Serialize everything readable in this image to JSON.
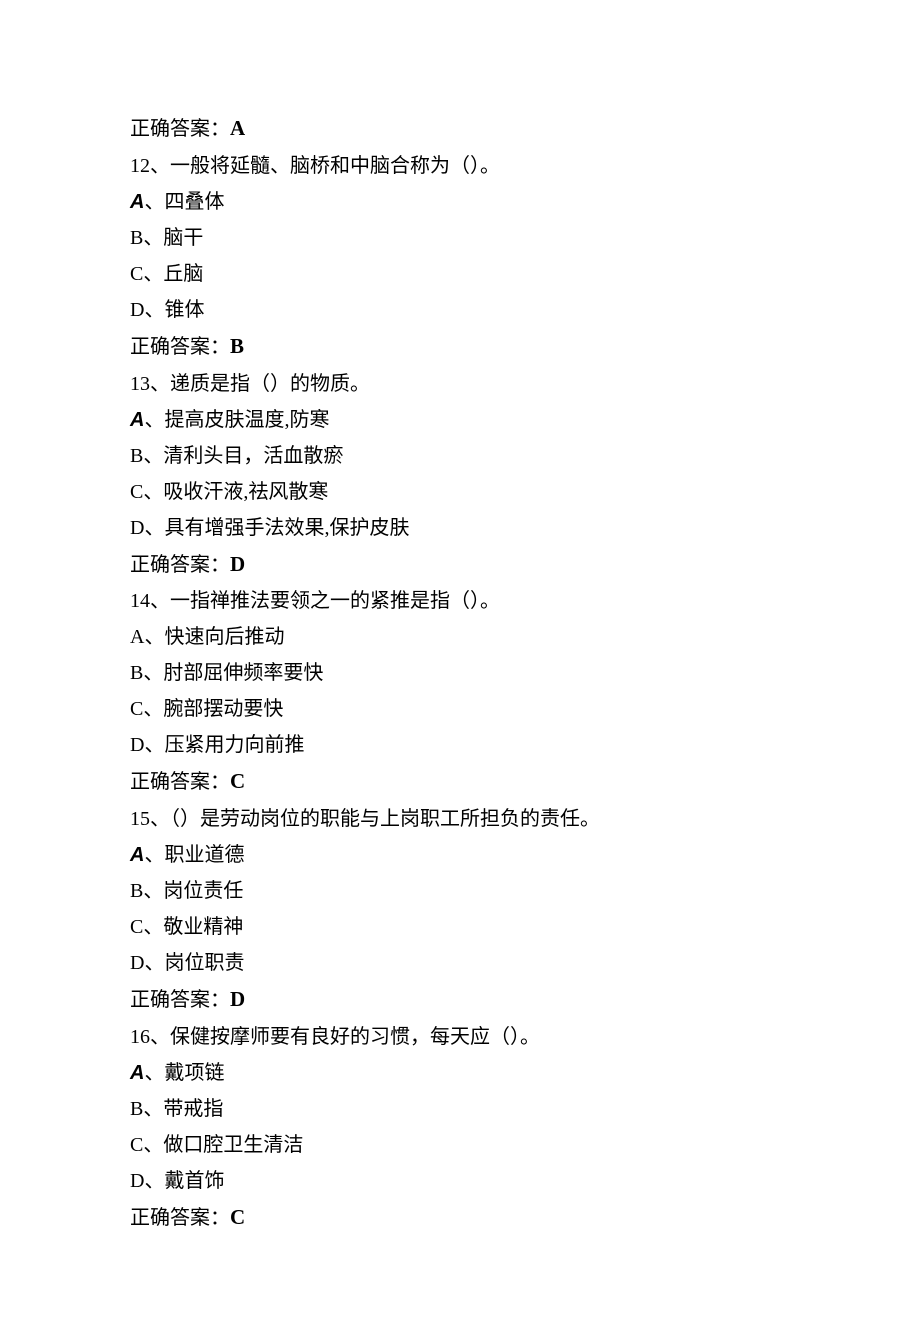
{
  "answer_label": "正确答案：",
  "q11_answer": "A",
  "q12": {
    "stem": "12、一般将延髓、脑桥和中脑合称为（）。",
    "a_letter": "A",
    "a_text": "、四叠体",
    "b": "B、脑干",
    "c": "C、丘脑",
    "d": "D、锥体",
    "answer": "B"
  },
  "q13": {
    "stem": "13、递质是指（）的物质。",
    "a_letter": "A",
    "a_text": "、提高皮肤温度,防寒",
    "b": "B、清利头目，活血散瘀",
    "c": "C、吸收汗液,祛风散寒",
    "d": "D、具有增强手法效果,保护皮肤",
    "answer": "D"
  },
  "q14": {
    "stem": "14、一指禅推法要领之一的紧推是指（）。",
    "a": "A、快速向后推动",
    "b": "B、肘部屈伸频率要快",
    "c": "C、腕部摆动要快",
    "d": "D、压紧用力向前推",
    "answer": "C"
  },
  "q15": {
    "stem": "15、（）是劳动岗位的职能与上岗职工所担负的责任。",
    "a_letter": "A",
    "a_text": "、职业道德",
    "b": "B、岗位责任",
    "c": "C、敬业精神",
    "d": "D、岗位职责",
    "answer": "D"
  },
  "q16": {
    "stem": "16、保健按摩师要有良好的习惯，每天应（）。",
    "a_letter": "A",
    "a_text": "、戴项链",
    "b": "B、带戒指",
    "c": "C、做口腔卫生清洁",
    "d": "D、戴首饰",
    "answer": "C"
  }
}
